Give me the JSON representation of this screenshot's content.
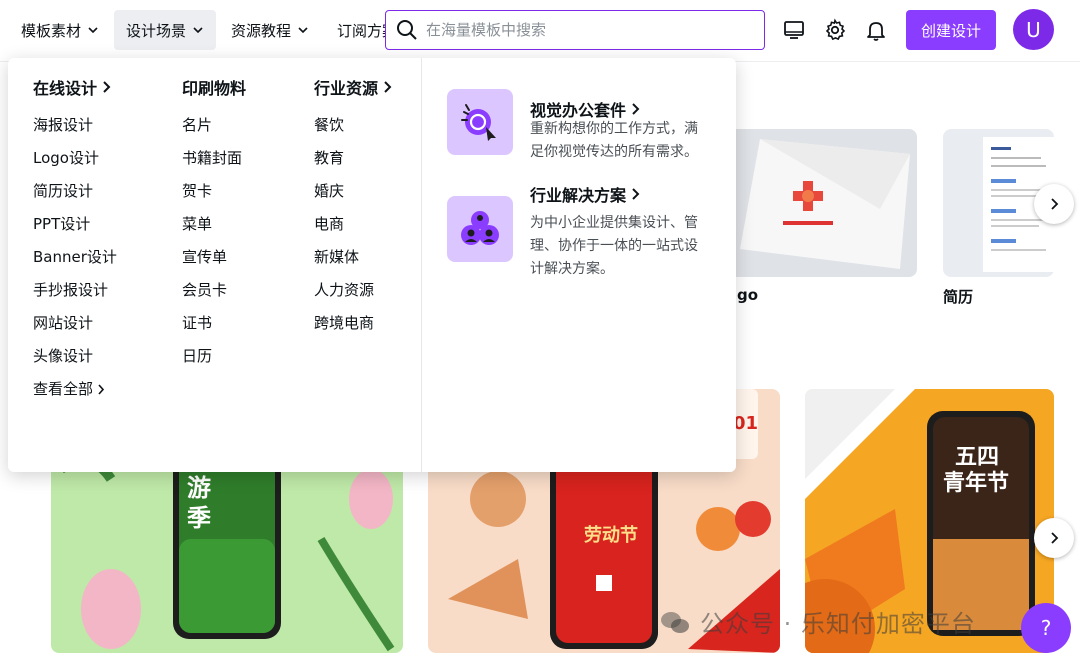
{
  "nav": {
    "items": [
      {
        "label": "模板素材"
      },
      {
        "label": "设计场景"
      },
      {
        "label": "资源教程"
      },
      {
        "label": "订阅方案"
      }
    ],
    "search_placeholder": "在海量模板中搜索",
    "create_label": "创建设计",
    "avatar_letter": "U"
  },
  "menu": {
    "col1": {
      "heading": "在线设计",
      "links": [
        "海报设计",
        "Logo设计",
        "简历设计",
        "PPT设计",
        "Banner设计",
        "手抄报设计",
        "网站设计",
        "头像设计"
      ],
      "view_all": "查看全部"
    },
    "col2": {
      "heading": "印刷物料",
      "links": [
        "名片",
        "书籍封面",
        "贺卡",
        "菜单",
        "宣传单",
        "会员卡",
        "证书",
        "日历"
      ]
    },
    "col3": {
      "heading": "行业资源",
      "links": [
        "餐饮",
        "教育",
        "婚庆",
        "电商",
        "新媒体",
        "人力资源",
        "跨境电商"
      ]
    },
    "features": [
      {
        "title": "视觉办公套件",
        "desc": "重新构想你的工作方式，满足你视觉传达的所有需求。",
        "icon": "visual-suite-icon"
      },
      {
        "title": "行业解决方案",
        "desc": "为中小企业提供集设计、管理、协作于一体的一站式设计解决方案。",
        "icon": "team-solution-icon"
      }
    ]
  },
  "background": {
    "card_labels": [
      "go",
      "简历"
    ],
    "poster_texts": {
      "travel": "游季",
      "may_day": "劳动节",
      "youth_day_top": "五四",
      "youth_day_bottom": "青年节",
      "calendar": "01"
    }
  },
  "watermark": "公众号 · 乐知付加密平台",
  "help_label": "?",
  "colors": {
    "brand": "#8b3dff",
    "search_border": "#7d2ae8",
    "icon_bg": "#dcc6ff"
  }
}
